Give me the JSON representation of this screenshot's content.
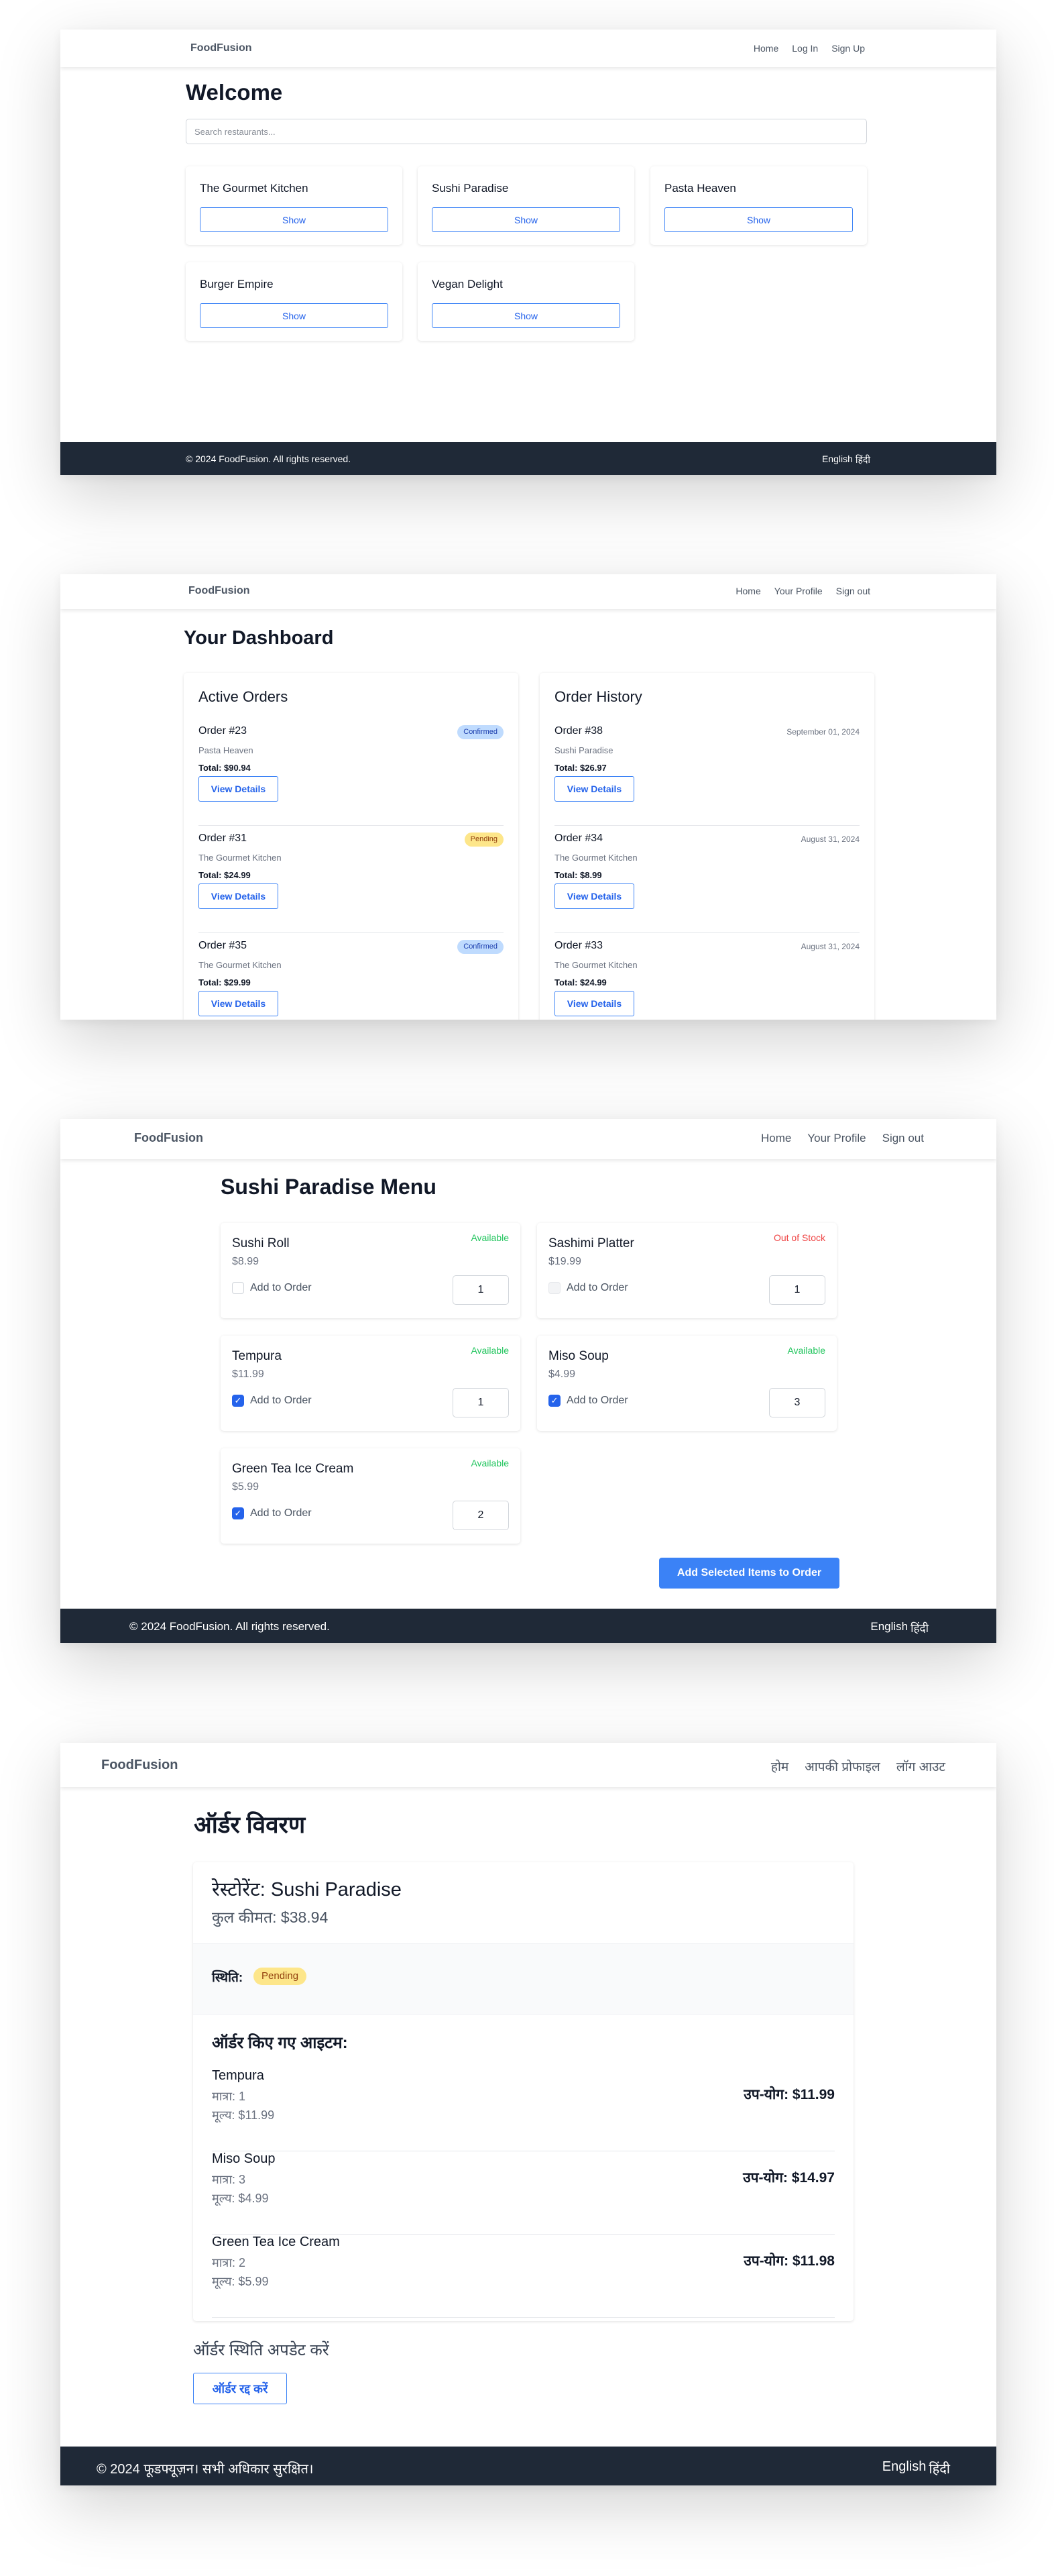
{
  "colors": {
    "accent": "#3b82f6",
    "footer_bg": "#1f2937",
    "available": "#22c55e",
    "out_of_stock": "#ef4444",
    "badge_confirmed": "#bfdbfe",
    "badge_pending": "#fde68a"
  },
  "screen1": {
    "brand": "FoodFusion",
    "nav": [
      "Home",
      "Log In",
      "Sign Up"
    ],
    "title": "Welcome",
    "search_placeholder": "Search restaurants...",
    "restaurants": [
      {
        "name": "The Gourmet Kitchen",
        "button": "Show"
      },
      {
        "name": "Sushi Paradise",
        "button": "Show"
      },
      {
        "name": "Pasta Heaven",
        "button": "Show"
      },
      {
        "name": "Burger Empire",
        "button": "Show"
      },
      {
        "name": "Vegan Delight",
        "button": "Show"
      }
    ],
    "footer": {
      "copyright": "© 2024 FoodFusion. All rights reserved.",
      "lang_en": "English",
      "lang_hi": "हिंदी"
    }
  },
  "screen2": {
    "brand": "FoodFusion",
    "nav": [
      "Home",
      "Your Profile",
      "Sign out"
    ],
    "title": "Your Dashboard",
    "active": {
      "title": "Active Orders",
      "orders": [
        {
          "name": "Order #23",
          "status": "Confirmed",
          "restaurant": "Pasta Heaven",
          "total": "Total: $90.94",
          "button": "View Details"
        },
        {
          "name": "Order #31",
          "status": "Pending",
          "restaurant": "The Gourmet Kitchen",
          "total": "Total: $24.99",
          "button": "View Details"
        },
        {
          "name": "Order #35",
          "status": "Confirmed",
          "restaurant": "The Gourmet Kitchen",
          "total": "Total: $29.99",
          "button": "View Details"
        }
      ]
    },
    "history": {
      "title": "Order History",
      "orders": [
        {
          "name": "Order #38",
          "date": "September 01, 2024",
          "restaurant": "Sushi Paradise",
          "total": "Total: $26.97",
          "button": "View Details"
        },
        {
          "name": "Order #34",
          "date": "August 31, 2024",
          "restaurant": "The Gourmet Kitchen",
          "total": "Total: $8.99",
          "button": "View Details"
        },
        {
          "name": "Order #33",
          "date": "August 31, 2024",
          "restaurant": "The Gourmet Kitchen",
          "total": "Total: $24.99",
          "button": "View Details"
        }
      ]
    }
  },
  "screen3": {
    "brand": "FoodFusion",
    "nav": [
      "Home",
      "Your Profile",
      "Sign out"
    ],
    "title": "Sushi Paradise Menu",
    "items": [
      {
        "name": "Sushi Roll",
        "price": "$8.99",
        "availability": "Available",
        "add_label": "Add to Order",
        "checked": false,
        "disabled": false,
        "qty": "1"
      },
      {
        "name": "Sashimi Platter",
        "price": "$19.99",
        "availability": "Out of Stock",
        "add_label": "Add to Order",
        "checked": false,
        "disabled": true,
        "qty": "1"
      },
      {
        "name": "Tempura",
        "price": "$11.99",
        "availability": "Available",
        "add_label": "Add to Order",
        "checked": true,
        "disabled": false,
        "qty": "1"
      },
      {
        "name": "Miso Soup",
        "price": "$4.99",
        "availability": "Available",
        "add_label": "Add to Order",
        "checked": true,
        "disabled": false,
        "qty": "3"
      },
      {
        "name": "Green Tea Ice Cream",
        "price": "$5.99",
        "availability": "Available",
        "add_label": "Add to Order",
        "checked": true,
        "disabled": false,
        "qty": "2"
      }
    ],
    "submit": "Add Selected Items to Order",
    "footer": {
      "copyright": "© 2024 FoodFusion. All rights reserved.",
      "lang_en": "English",
      "lang_hi": "हिंदी"
    }
  },
  "screen4": {
    "brand": "FoodFusion",
    "nav": [
      "होम",
      "आपकी प्रोफाइल",
      "लॉग आउट"
    ],
    "title": "ऑर्डर विवरण",
    "restaurant": "रेस्टोरेंट: Sushi Paradise",
    "total": "कुल कीमत: $38.94",
    "status_label": "स्थिति:",
    "status": "Pending",
    "items_heading": "ऑर्डर किए गए आइटम:",
    "items": [
      {
        "name": "Tempura",
        "qty": "मात्रा: 1",
        "price": "मूल्य: $11.99",
        "subtotal": "उप-योग: $11.99"
      },
      {
        "name": "Miso Soup",
        "qty": "मात्रा: 3",
        "price": "मूल्य: $4.99",
        "subtotal": "उप-योग: $14.97"
      },
      {
        "name": "Green Tea Ice Cream",
        "qty": "मात्रा: 2",
        "price": "मूल्य: $5.99",
        "subtotal": "उप-योग: $11.98"
      }
    ],
    "update_heading": "ऑर्डर स्थिति अपडेट करें",
    "cancel_button": "ऑर्डर रद्द करें",
    "footer": {
      "copyright": "© 2024 फूडफ्यूज़न। सभी अधिकार सुरक्षित।",
      "lang_en": "English",
      "lang_hi": "हिंदी"
    }
  }
}
